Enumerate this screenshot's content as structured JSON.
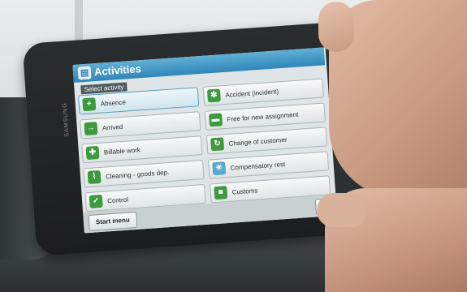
{
  "app": {
    "title": "Activities",
    "subtitle": "Select activity",
    "icon": "clipboard-icon"
  },
  "activities": [
    {
      "label": "Absence",
      "icon": "plus-person-icon",
      "color": "#3e9a3e"
    },
    {
      "label": "Accident (incident)",
      "icon": "gear-icon",
      "color": "#3e9a3e"
    },
    {
      "label": "Arrived",
      "icon": "arrive-icon",
      "color": "#3e9a3e"
    },
    {
      "label": "Free for new assignment",
      "icon": "bed-icon",
      "color": "#3e9a3e"
    },
    {
      "label": "Billable work",
      "icon": "tools-icon",
      "color": "#3e9a3e"
    },
    {
      "label": "Change of customer",
      "icon": "swap-icon",
      "color": "#3e9a3e"
    },
    {
      "label": "Cleaning - goods dep.",
      "icon": "broom-icon",
      "color": "#3e9a3e"
    },
    {
      "label": "Compensatory rest",
      "icon": "sun-icon",
      "color": "#5aa7d0"
    },
    {
      "label": "Control",
      "icon": "check-icon",
      "color": "#3e9a3e"
    },
    {
      "label": "Customs",
      "icon": "customs-icon",
      "color": "#3e9a3e"
    }
  ],
  "footer": {
    "start_menu": "Start menu",
    "back": "Ba"
  },
  "device": {
    "brand": "SAMSUNG"
  }
}
